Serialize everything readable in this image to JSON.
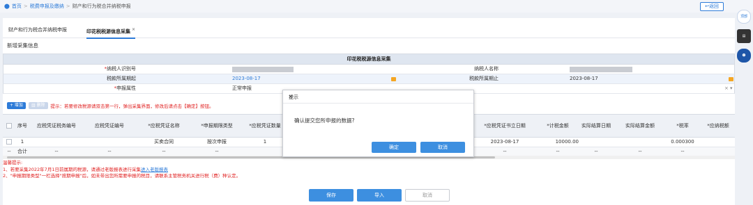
{
  "breadcrumb": {
    "home": "首页",
    "level1": "税费申报及缴纳",
    "level2": "财产和行为税合并纳税申报"
  },
  "back_button": "返回",
  "tabs": [
    {
      "label": "财产和行为税合并纳税申报"
    },
    {
      "label": "印花税税源信息采集",
      "close": "×"
    }
  ],
  "section_title": "新增采集信息",
  "form": {
    "title": "印花税税源信息采集",
    "taxpayer_id_label": "*纳税人识别号",
    "taxpayer_name_label": "纳税人名称",
    "period_start_label": "税款所属期起",
    "period_start": "2023-08-17",
    "period_end_label": "税款所属期止",
    "period_end": "2023-08-17",
    "declare_attr_label": "*申报属性",
    "declare_attr": "正常申报",
    "declare_attr_clear": "×",
    "declare_attr_arrow": "▾"
  },
  "toolbar": {
    "add": "+ 增加",
    "delete": "删除",
    "tip": "提示：若要修改税源请双击第一行，弹出采集界面，修改后请点击【确定】按钮。"
  },
  "table": {
    "headers": [
      "序号",
      "应税凭证税务编号",
      "应税凭证编号",
      "*应税凭证名称",
      "*申报期限类型",
      "*应税凭证数量",
      "*应税凭证书立日期",
      "*计税金额",
      "实际结算日期",
      "实际结算金额",
      "*税率",
      "*应纳税额"
    ],
    "row": {
      "index": "1",
      "name": "买卖合同",
      "period_type": "按次申报",
      "quantity": "1",
      "date": "2023-08-17",
      "amount": "10000.00",
      "rate": "0.000300"
    },
    "sum": {
      "dash": "--",
      "label": "合计",
      "cells": [
        "--",
        "--",
        "--",
        "--",
        "--",
        "--",
        "--",
        "--",
        "--"
      ]
    }
  },
  "warm_tips": {
    "title": "温馨提示:",
    "line1": "1、若要采集2022年7月1日前属期的税源，请通过老版报表进行采集",
    "line1_link": "进入老版报表",
    "line2": "2、\"申报期限类型\"一栏选择\"按期申报\"后，如未带出您所需要申报的税目，请联系主管税务机关进行税（费）种认定。"
  },
  "buttons": {
    "save": "保存",
    "import": "导入",
    "cancel": "取消"
  },
  "dialog": {
    "title": "提示",
    "close": "×",
    "message": "确认提交您所申报的数据?",
    "confirm": "确定",
    "cancel": "取消"
  },
  "side": {
    "top": "顶部"
  },
  "colors": {
    "accent": "#2d7bd8",
    "warning": "#e02020",
    "calendar": "#f5a623"
  }
}
